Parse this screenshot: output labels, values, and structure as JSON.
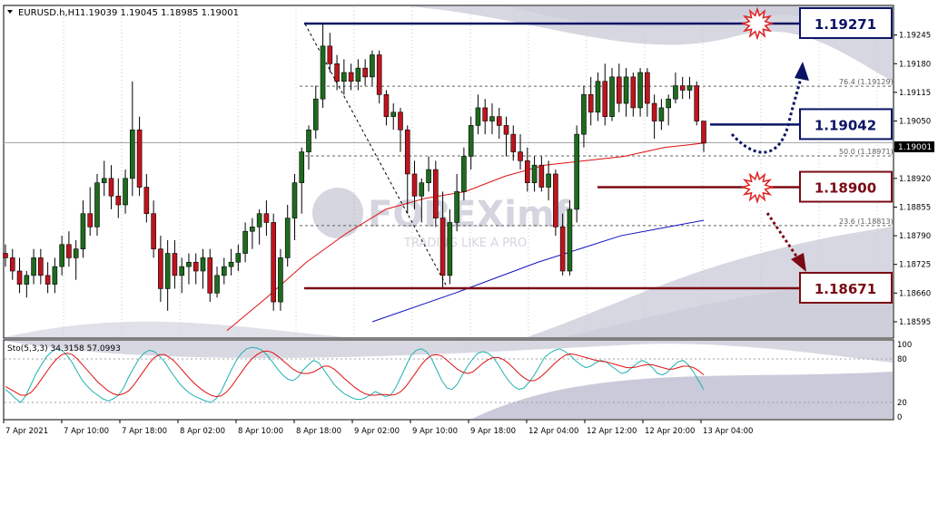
{
  "header": {
    "symbol": "EURUSD.h,H1",
    "ohlc": "1.19039 1.19045 1.18985 1.19001"
  },
  "watermark": {
    "brand": "FOREXimf",
    "tagline": "TRADING LIKE A PRO"
  },
  "colors": {
    "bull": "#1e6b1e",
    "bear": "#c0141e",
    "ma_fast": "#e01010",
    "ma_slow": "#1010c0",
    "level_blue": "#0a1464",
    "level_red": "#7a0a14",
    "stoch_main": "#20b0b0",
    "stoch_signal": "#e01010"
  },
  "chart_data": [
    {
      "type": "candlestick",
      "title": "EURUSD.h,H1",
      "ylim": [
        1.1856,
        1.1931
      ],
      "y_ticks": [
        "1.19245",
        "1.19180",
        "1.19115",
        "1.19050",
        "1.18985",
        "1.18920",
        "1.18855",
        "1.18790",
        "1.18725",
        "1.18660",
        "1.18595"
      ],
      "x_tick_labels": [
        "7 Apr 2021",
        "7 Apr 10:00",
        "7 Apr 18:00",
        "8 Apr 02:00",
        "8 Apr 10:00",
        "8 Apr 18:00",
        "9 Apr 02:00",
        "9 Apr 10:00",
        "9 Apr 18:00",
        "12 Apr 04:00",
        "12 Apr 12:00",
        "12 Apr 20:00",
        "13 Apr 04:00"
      ],
      "current_price": "1.19001",
      "fib_levels": [
        {
          "label": "76.4 (1.19129)",
          "value": 1.19129
        },
        {
          "label": "50.0 (1.18971)",
          "value": 1.18971
        },
        {
          "label": "23.6 (1.18813)",
          "value": 1.18813
        }
      ],
      "levels": [
        {
          "label": "1.19271",
          "value": 1.19271,
          "kind": "resistance"
        },
        {
          "label": "1.19042",
          "value": 1.19042,
          "kind": "pivot"
        },
        {
          "label": "1.18900",
          "value": 1.189,
          "kind": "support"
        },
        {
          "label": "1.18671",
          "value": 1.18671,
          "kind": "support"
        }
      ],
      "candles": [
        [
          1.1875,
          1.1877,
          1.1872,
          1.1874
        ],
        [
          1.1874,
          1.1876,
          1.1869,
          1.1871
        ],
        [
          1.1871,
          1.1874,
          1.1866,
          1.1868
        ],
        [
          1.1868,
          1.1871,
          1.1865,
          1.187
        ],
        [
          1.187,
          1.1876,
          1.1868,
          1.1874
        ],
        [
          1.1874,
          1.1876,
          1.1868,
          1.187
        ],
        [
          1.187,
          1.1873,
          1.1866,
          1.1868
        ],
        [
          1.1868,
          1.1874,
          1.1866,
          1.1872
        ],
        [
          1.1872,
          1.1879,
          1.187,
          1.1877
        ],
        [
          1.1877,
          1.188,
          1.1872,
          1.1874
        ],
        [
          1.1874,
          1.1878,
          1.1869,
          1.1876
        ],
        [
          1.1876,
          1.1887,
          1.1874,
          1.1884
        ],
        [
          1.1884,
          1.189,
          1.1879,
          1.1881
        ],
        [
          1.1881,
          1.1893,
          1.1879,
          1.1891
        ],
        [
          1.1891,
          1.1896,
          1.1888,
          1.1892
        ],
        [
          1.1892,
          1.1895,
          1.1885,
          1.1888
        ],
        [
          1.1888,
          1.1892,
          1.1883,
          1.1886
        ],
        [
          1.1886,
          1.1894,
          1.1884,
          1.1892
        ],
        [
          1.1892,
          1.1914,
          1.1888,
          1.1903
        ],
        [
          1.1903,
          1.1906,
          1.1888,
          1.189
        ],
        [
          1.189,
          1.1893,
          1.1882,
          1.1884
        ],
        [
          1.1884,
          1.1887,
          1.1874,
          1.1876
        ],
        [
          1.1876,
          1.1879,
          1.1864,
          1.1867
        ],
        [
          1.1867,
          1.1878,
          1.1862,
          1.1875
        ],
        [
          1.1875,
          1.1878,
          1.1867,
          1.187
        ],
        [
          1.187,
          1.1874,
          1.1866,
          1.1872
        ],
        [
          1.1872,
          1.1875,
          1.1868,
          1.1873
        ],
        [
          1.1873,
          1.1875,
          1.1868,
          1.1871
        ],
        [
          1.1871,
          1.1876,
          1.1867,
          1.1874
        ],
        [
          1.1874,
          1.1876,
          1.1864,
          1.1866
        ],
        [
          1.1866,
          1.1872,
          1.1865,
          1.187
        ],
        [
          1.187,
          1.1874,
          1.1868,
          1.1872
        ],
        [
          1.1872,
          1.1876,
          1.187,
          1.1873
        ],
        [
          1.1873,
          1.1877,
          1.1871,
          1.1875
        ],
        [
          1.1875,
          1.1882,
          1.1873,
          1.188
        ],
        [
          1.188,
          1.1883,
          1.1876,
          1.1881
        ],
        [
          1.1881,
          1.1885,
          1.1877,
          1.1884
        ],
        [
          1.1884,
          1.1887,
          1.1879,
          1.1882
        ],
        [
          1.1882,
          1.1884,
          1.1862,
          1.1864
        ],
        [
          1.1864,
          1.1876,
          1.1862,
          1.1874
        ],
        [
          1.1874,
          1.1886,
          1.1872,
          1.1883
        ],
        [
          1.1883,
          1.1893,
          1.1878,
          1.1891
        ],
        [
          1.1891,
          1.1899,
          1.1884,
          1.1898
        ],
        [
          1.1898,
          1.1904,
          1.1894,
          1.1903
        ],
        [
          1.1903,
          1.1913,
          1.1901,
          1.191
        ],
        [
          1.191,
          1.1927,
          1.1908,
          1.1922
        ],
        [
          1.1922,
          1.1925,
          1.1916,
          1.1918
        ],
        [
          1.1918,
          1.192,
          1.1912,
          1.1914
        ],
        [
          1.1914,
          1.1919,
          1.1911,
          1.1916
        ],
        [
          1.1916,
          1.1918,
          1.1912,
          1.1914
        ],
        [
          1.1914,
          1.1919,
          1.1912,
          1.1917
        ],
        [
          1.1917,
          1.1919,
          1.1913,
          1.1915
        ],
        [
          1.1915,
          1.1921,
          1.1913,
          1.192
        ],
        [
          1.192,
          1.1921,
          1.1909,
          1.1911
        ],
        [
          1.1911,
          1.1912,
          1.1904,
          1.1906
        ],
        [
          1.1906,
          1.1909,
          1.1903,
          1.1907
        ],
        [
          1.1907,
          1.1908,
          1.1898,
          1.1903
        ],
        [
          1.1903,
          1.1904,
          1.1884,
          1.1893
        ],
        [
          1.1893,
          1.1896,
          1.1885,
          1.1888
        ],
        [
          1.1888,
          1.1892,
          1.1882,
          1.1891
        ],
        [
          1.1891,
          1.1897,
          1.1889,
          1.1894
        ],
        [
          1.1894,
          1.1896,
          1.1881,
          1.1883
        ],
        [
          1.1883,
          1.1889,
          1.1867,
          1.187
        ],
        [
          1.187,
          1.1885,
          1.1868,
          1.1882
        ],
        [
          1.1882,
          1.1893,
          1.188,
          1.1889
        ],
        [
          1.1889,
          1.1899,
          1.1887,
          1.1897
        ],
        [
          1.1897,
          1.1906,
          1.1894,
          1.1904
        ],
        [
          1.1904,
          1.1911,
          1.1902,
          1.1908
        ],
        [
          1.1908,
          1.191,
          1.1902,
          1.1905
        ],
        [
          1.1905,
          1.1909,
          1.1902,
          1.1906
        ],
        [
          1.1906,
          1.1908,
          1.1901,
          1.1904
        ],
        [
          1.1904,
          1.1906,
          1.1897,
          1.1902
        ],
        [
          1.1902,
          1.1904,
          1.1896,
          1.1898
        ],
        [
          1.1898,
          1.1902,
          1.1894,
          1.1896
        ],
        [
          1.1896,
          1.1899,
          1.1889,
          1.1891
        ],
        [
          1.1891,
          1.1897,
          1.1889,
          1.1895
        ],
        [
          1.1895,
          1.1897,
          1.1889,
          1.189
        ],
        [
          1.189,
          1.1896,
          1.1887,
          1.1893
        ],
        [
          1.1893,
          1.1894,
          1.1879,
          1.1881
        ],
        [
          1.1881,
          1.1884,
          1.187,
          1.1871
        ],
        [
          1.1871,
          1.1887,
          1.187,
          1.1885
        ],
        [
          1.1885,
          1.1904,
          1.1882,
          1.1902
        ],
        [
          1.1902,
          1.1913,
          1.1899,
          1.1911
        ],
        [
          1.1911,
          1.1915,
          1.1904,
          1.1907
        ],
        [
          1.1907,
          1.1916,
          1.1905,
          1.1914
        ],
        [
          1.1914,
          1.1918,
          1.1904,
          1.1906
        ],
        [
          1.1906,
          1.1917,
          1.1905,
          1.1915
        ],
        [
          1.1915,
          1.1918,
          1.1907,
          1.1909
        ],
        [
          1.1909,
          1.1917,
          1.1906,
          1.1915
        ],
        [
          1.1915,
          1.1916,
          1.1906,
          1.1908
        ],
        [
          1.1908,
          1.1917,
          1.1906,
          1.1916
        ],
        [
          1.1916,
          1.1917,
          1.1906,
          1.1909
        ],
        [
          1.1909,
          1.1911,
          1.1901,
          1.1905
        ],
        [
          1.1905,
          1.191,
          1.1903,
          1.1908
        ],
        [
          1.1908,
          1.1911,
          1.1904,
          1.191
        ],
        [
          1.191,
          1.1916,
          1.1909,
          1.1913
        ],
        [
          1.1913,
          1.1915,
          1.191,
          1.1912
        ],
        [
          1.1912,
          1.1915,
          1.191,
          1.1913
        ],
        [
          1.1913,
          1.1914,
          1.1904,
          1.1905
        ],
        [
          1.1905,
          1.1905,
          1.1898,
          1.19
        ]
      ],
      "ma_fast": [
        1.18575,
        1.1865,
        1.1873,
        1.18795,
        1.1885,
        1.18875,
        1.1889,
        1.18925,
        1.1895,
        1.1896,
        1.1897,
        1.1899,
        1.19
      ],
      "ma_slow": [
        1.18595,
        1.1866,
        1.1873,
        1.1879,
        1.18825
      ]
    },
    {
      "type": "line",
      "title": "Sto(5,3,3) 34.3158 57.0993",
      "ylim": [
        0,
        100
      ],
      "y_ticks": [
        "100",
        "80",
        "20",
        "0"
      ],
      "series": [
        {
          "name": "34.3158",
          "values": [
            38,
            32,
            25,
            20,
            30,
            45,
            60,
            72,
            83,
            90,
            94,
            92,
            85,
            75,
            62,
            50,
            42,
            35,
            30,
            25,
            22,
            25,
            30,
            40,
            55,
            68,
            80,
            88,
            92,
            90,
            84,
            76,
            65,
            55,
            45,
            38,
            32,
            28,
            25,
            22,
            20,
            25,
            35,
            50,
            65,
            78,
            88,
            94,
            96,
            95,
            92,
            85,
            76,
            66,
            58,
            52,
            50,
            55,
            65,
            72,
            78,
            75,
            65,
            55,
            45,
            38,
            32,
            28,
            25,
            24,
            26,
            30,
            35,
            32,
            28,
            30,
            40,
            55,
            70,
            85,
            92,
            94,
            90,
            80,
            65,
            50,
            40,
            38,
            45,
            58,
            70,
            80,
            88,
            90,
            88,
            82,
            72,
            60,
            50,
            42,
            38,
            40,
            48,
            58,
            70,
            82,
            88,
            92,
            94,
            90,
            85,
            78,
            72,
            68,
            70,
            75,
            78,
            76,
            70,
            65,
            60,
            62,
            68,
            74,
            78,
            75,
            68,
            60,
            58,
            62,
            70,
            76,
            78,
            72,
            62,
            50,
            38
          ]
        },
        {
          "name": "57.0993",
          "values": [
            42,
            38,
            34,
            30,
            30,
            34,
            42,
            52,
            62,
            72,
            80,
            86,
            88,
            86,
            80,
            72,
            64,
            56,
            48,
            42,
            36,
            32,
            30,
            32,
            36,
            44,
            54,
            64,
            74,
            82,
            86,
            86,
            82,
            76,
            68,
            60,
            52,
            45,
            39,
            34,
            30,
            28,
            29,
            34,
            42,
            52,
            62,
            72,
            80,
            86,
            90,
            91,
            89,
            84,
            78,
            72,
            66,
            62,
            60,
            60,
            62,
            66,
            70,
            70,
            66,
            60,
            53,
            47,
            41,
            36,
            32,
            30,
            30,
            31,
            31,
            30,
            31,
            35,
            42,
            52,
            62,
            72,
            80,
            85,
            86,
            84,
            78,
            72,
            66,
            62,
            60,
            62,
            68,
            74,
            79,
            82,
            82,
            79,
            74,
            67,
            60,
            54,
            50,
            50,
            54,
            60,
            67,
            74,
            80,
            85,
            87,
            86,
            84,
            82,
            80,
            78,
            77,
            76,
            74,
            72,
            70,
            68,
            68,
            69,
            71,
            72,
            72,
            70,
            68,
            66,
            66,
            68,
            70,
            70,
            68,
            64,
            58
          ]
        }
      ]
    }
  ]
}
